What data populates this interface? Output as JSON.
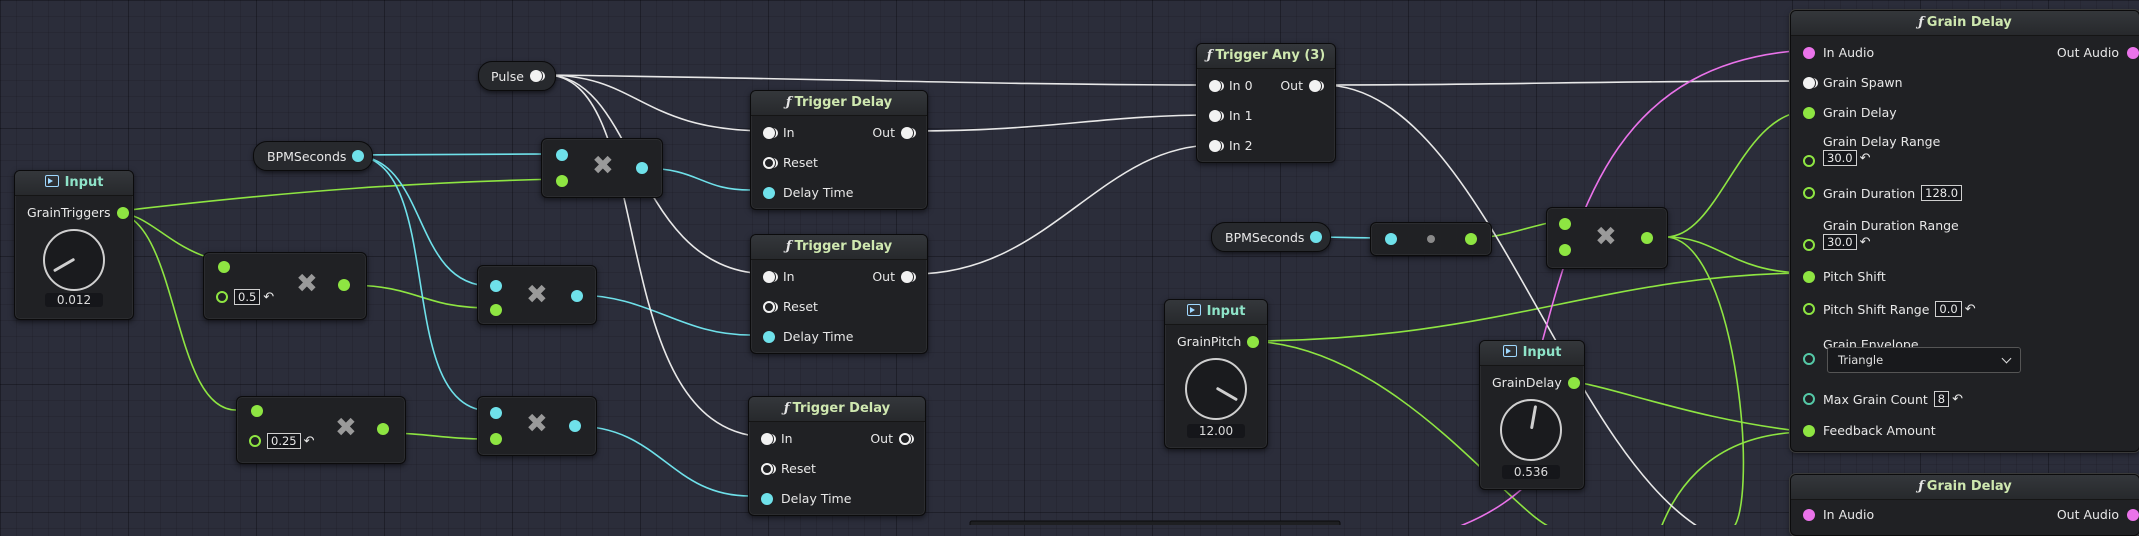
{
  "nodes": {
    "input_grain_triggers": {
      "title": "Input",
      "pin_label": "GrainTriggers",
      "value": "0.012"
    },
    "pulse": {
      "label": "Pulse"
    },
    "bpm_seconds_1": {
      "label": "BPMSeconds"
    },
    "mult_a": {
      "value": "0.5"
    },
    "mult_b": {
      "value": "0.25"
    },
    "trigger_delay_1": {
      "title": "Trigger Delay",
      "in": "In",
      "reset": "Reset",
      "delay_time": "Delay Time",
      "out": "Out"
    },
    "trigger_delay_2": {
      "title": "Trigger Delay",
      "in": "In",
      "reset": "Reset",
      "delay_time": "Delay Time",
      "out": "Out"
    },
    "trigger_delay_3": {
      "title": "Trigger Delay",
      "in": "In",
      "reset": "Reset",
      "delay_time": "Delay Time",
      "out": "Out"
    },
    "trigger_any": {
      "title": "Trigger Any (3)",
      "in0": "In 0",
      "in1": "In 1",
      "in2": "In 2",
      "out": "Out"
    },
    "bpm_seconds_2": {
      "label": "BPMSeconds"
    },
    "input_grain_pitch": {
      "title": "Input",
      "pin_label": "GrainPitch",
      "value": "12.00"
    },
    "input_grain_delay": {
      "title": "Input",
      "pin_label": "GrainDelay",
      "value": "0.536"
    },
    "grain_delay_1": {
      "title": "Grain Delay",
      "in_audio": "In Audio",
      "out_audio": "Out Audio",
      "grain_spawn": "Grain Spawn",
      "grain_delay": "Grain Delay",
      "grain_delay_range": "Grain Delay Range",
      "grain_delay_range_value": "30.0",
      "grain_duration": "Grain Duration",
      "grain_duration_value": "128.0",
      "grain_duration_range": "Grain Duration Range",
      "grain_duration_range_value": "30.0",
      "pitch_shift": "Pitch Shift",
      "pitch_shift_range": "Pitch Shift Range",
      "pitch_shift_range_value": "0.0",
      "grain_envelope": "Grain Envelope",
      "grain_envelope_value": "Triangle",
      "max_grain_count": "Max Grain Count",
      "max_grain_count_value": "8",
      "feedback_amount": "Feedback Amount"
    },
    "grain_delay_2": {
      "title": "Grain Delay",
      "in_audio": "In Audio",
      "out_audio": "Out Audio"
    }
  },
  "glyphs": {
    "function": "ƒ",
    "multiply": "✖",
    "reset_arrow": "↶"
  },
  "colors": {
    "background": "#2b2d3a",
    "float_pin": "#8ee542",
    "time_pin": "#6fe1ea",
    "audio_pin": "#ea73ea",
    "trigger_pin": "#f2f2f2",
    "enum_pin": "#55c9a7"
  },
  "icons": {
    "input_node": "input-arrow-icon",
    "multiply_node": "multiply-icon",
    "reset": "reset-arrow-icon",
    "dropdown": "chevron-down-icon"
  }
}
